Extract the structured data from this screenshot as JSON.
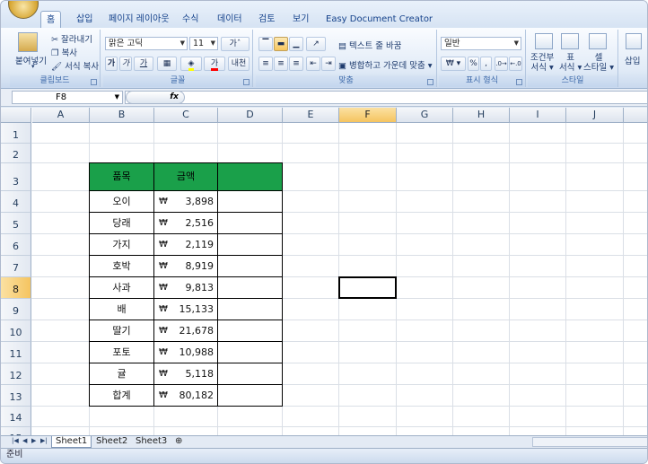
{
  "ribbon": {
    "tabs": [
      "홈",
      "삽입",
      "페이지 레이아웃",
      "수식",
      "데이터",
      "검토",
      "보기",
      "Easy Document Creator"
    ],
    "clipboard": {
      "paste": "붙여넣기",
      "cut": "잘라내기",
      "copy": "복사",
      "format_painter": "서식 복사",
      "label": "클립보드"
    },
    "font": {
      "name": "맑은 고딕",
      "size": "11",
      "bold": "가",
      "italic": "가",
      "underline": "가",
      "phonetic": "내천",
      "grow": "가",
      "label": "글꼴"
    },
    "alignment": {
      "wrap_text": "텍스트 줄 바꿈",
      "merge_center": "병합하고 가운데 맞춤",
      "label": "맞춤"
    },
    "number": {
      "format": "일반",
      "currency": "₩",
      "percent": "%",
      "comma": ",",
      "label": "표시 형식"
    },
    "styles": {
      "conditional": "조건부",
      "conditional2": "서식",
      "table": "표",
      "table2": "서식",
      "cell": "셀",
      "cell2": "스타일",
      "label": "스타일"
    },
    "cells": {
      "insert": "삽입"
    }
  },
  "formula_bar": {
    "name_box": "F8",
    "fx": "fx",
    "content": ""
  },
  "grid": {
    "columns": [
      "A",
      "B",
      "C",
      "D",
      "E",
      "F",
      "G",
      "H",
      "I",
      "J"
    ],
    "rows": [
      "1",
      "2",
      "3",
      "4",
      "5",
      "6",
      "7",
      "8",
      "9",
      "10",
      "11",
      "12",
      "13",
      "14",
      "15"
    ],
    "selected_column": "F",
    "selected_row": "8",
    "selected_cell": "F8"
  },
  "table": {
    "headers": [
      "품목",
      "금액",
      ""
    ],
    "currency_symbol": "₩",
    "rows": [
      {
        "item": "오이",
        "amount": "3,898"
      },
      {
        "item": "당래",
        "amount": "2,516"
      },
      {
        "item": "가지",
        "amount": "2,119"
      },
      {
        "item": "호박",
        "amount": "8,919"
      },
      {
        "item": "사과",
        "amount": "9,813"
      },
      {
        "item": "배",
        "amount": "15,133"
      },
      {
        "item": "딸기",
        "amount": "21,678"
      },
      {
        "item": "포토",
        "amount": "10,988"
      },
      {
        "item": "귤",
        "amount": "5,118"
      },
      {
        "item": "합계",
        "amount": "80,182"
      }
    ],
    "header_color": "#1aa04a"
  },
  "sheet_tabs": [
    "Sheet1",
    "Sheet2",
    "Sheet3"
  ],
  "status": {
    "text": "준비"
  }
}
